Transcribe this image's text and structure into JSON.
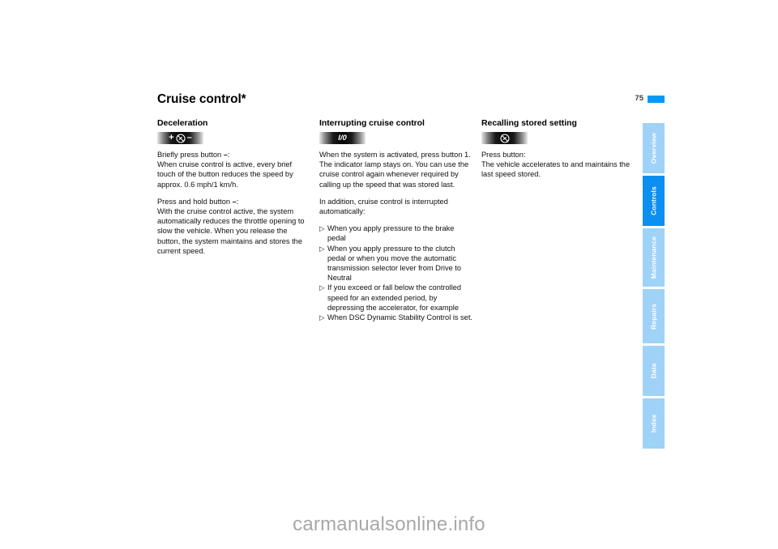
{
  "header": {
    "title": "Cruise control*",
    "page_number": "75",
    "accent_color": "#0099ff"
  },
  "columns": [
    {
      "heading": "Deceleration",
      "pictogram": {
        "name": "cruise-plus-minus-button",
        "glyphs": [
          "+",
          "cruise-control-icon",
          "–"
        ]
      },
      "paragraphs": [
        "Briefly press button –:\nWhen cruise control is active, every brief touch of the button reduces the speed by approx. 0.6 mph/1 km/h.",
        "Press and hold button –:\nWith the cruise control active, the system automatically reduces the throttle opening to slow the vehicle. When you release the button, the system maintains and stores the current speed."
      ],
      "para_1_line_1": "Briefly press button",
      "para_1_symbol": "–",
      "para_1_rest": ":",
      "para_1_body": "When cruise control is active, every brief touch of the button reduces the speed by approx. 0.6 mph/1 km/h.",
      "para_2_line_1": "Press and hold button",
      "para_2_symbol": "–",
      "para_2_rest": ":",
      "para_2_body": "With the cruise control active, the system automatically reduces the throttle opening to slow the vehicle. When you release the button, the system maintains and stores the current speed."
    },
    {
      "heading": "Interrupting cruise control",
      "pictogram": {
        "name": "io-button",
        "label": "I/0"
      },
      "para_1": "When the system is activated, press button 1. The indicator lamp stays on. You can use the cruise control again whenever required by calling up the speed that was stored last.",
      "para_2": "In addition, cruise control is interrupted automatically:",
      "bullet_marker": "▷",
      "bullets": [
        "When you apply pressure to the brake pedal",
        "When you apply pressure to the clutch pedal or when you move the automatic transmission selector lever from Drive to Neutral",
        "If you exceed or fall below the controlled speed for an extended period, by depressing the accelerator, for example",
        "When DSC Dynamic Stability Control is set."
      ]
    },
    {
      "heading": "Recalling stored setting",
      "pictogram": {
        "name": "cruise-resume-button",
        "glyphs": [
          "cruise-control-icon"
        ]
      },
      "para_1_line_1": "Press button:",
      "para_1_body": "The vehicle accelerates to and maintains the last speed stored."
    }
  ],
  "side_tabs": {
    "items": [
      {
        "label": "Overview",
        "active": false
      },
      {
        "label": "Controls",
        "active": true
      },
      {
        "label": "Maintenance",
        "active": false
      },
      {
        "label": "Repairs",
        "active": false
      },
      {
        "label": "Data",
        "active": false
      },
      {
        "label": "Index",
        "active": false
      }
    ],
    "inactive_color": "#9fd2f7",
    "active_color": "#0b8ff0"
  },
  "watermark": {
    "text": "carmanualsonline.info"
  }
}
